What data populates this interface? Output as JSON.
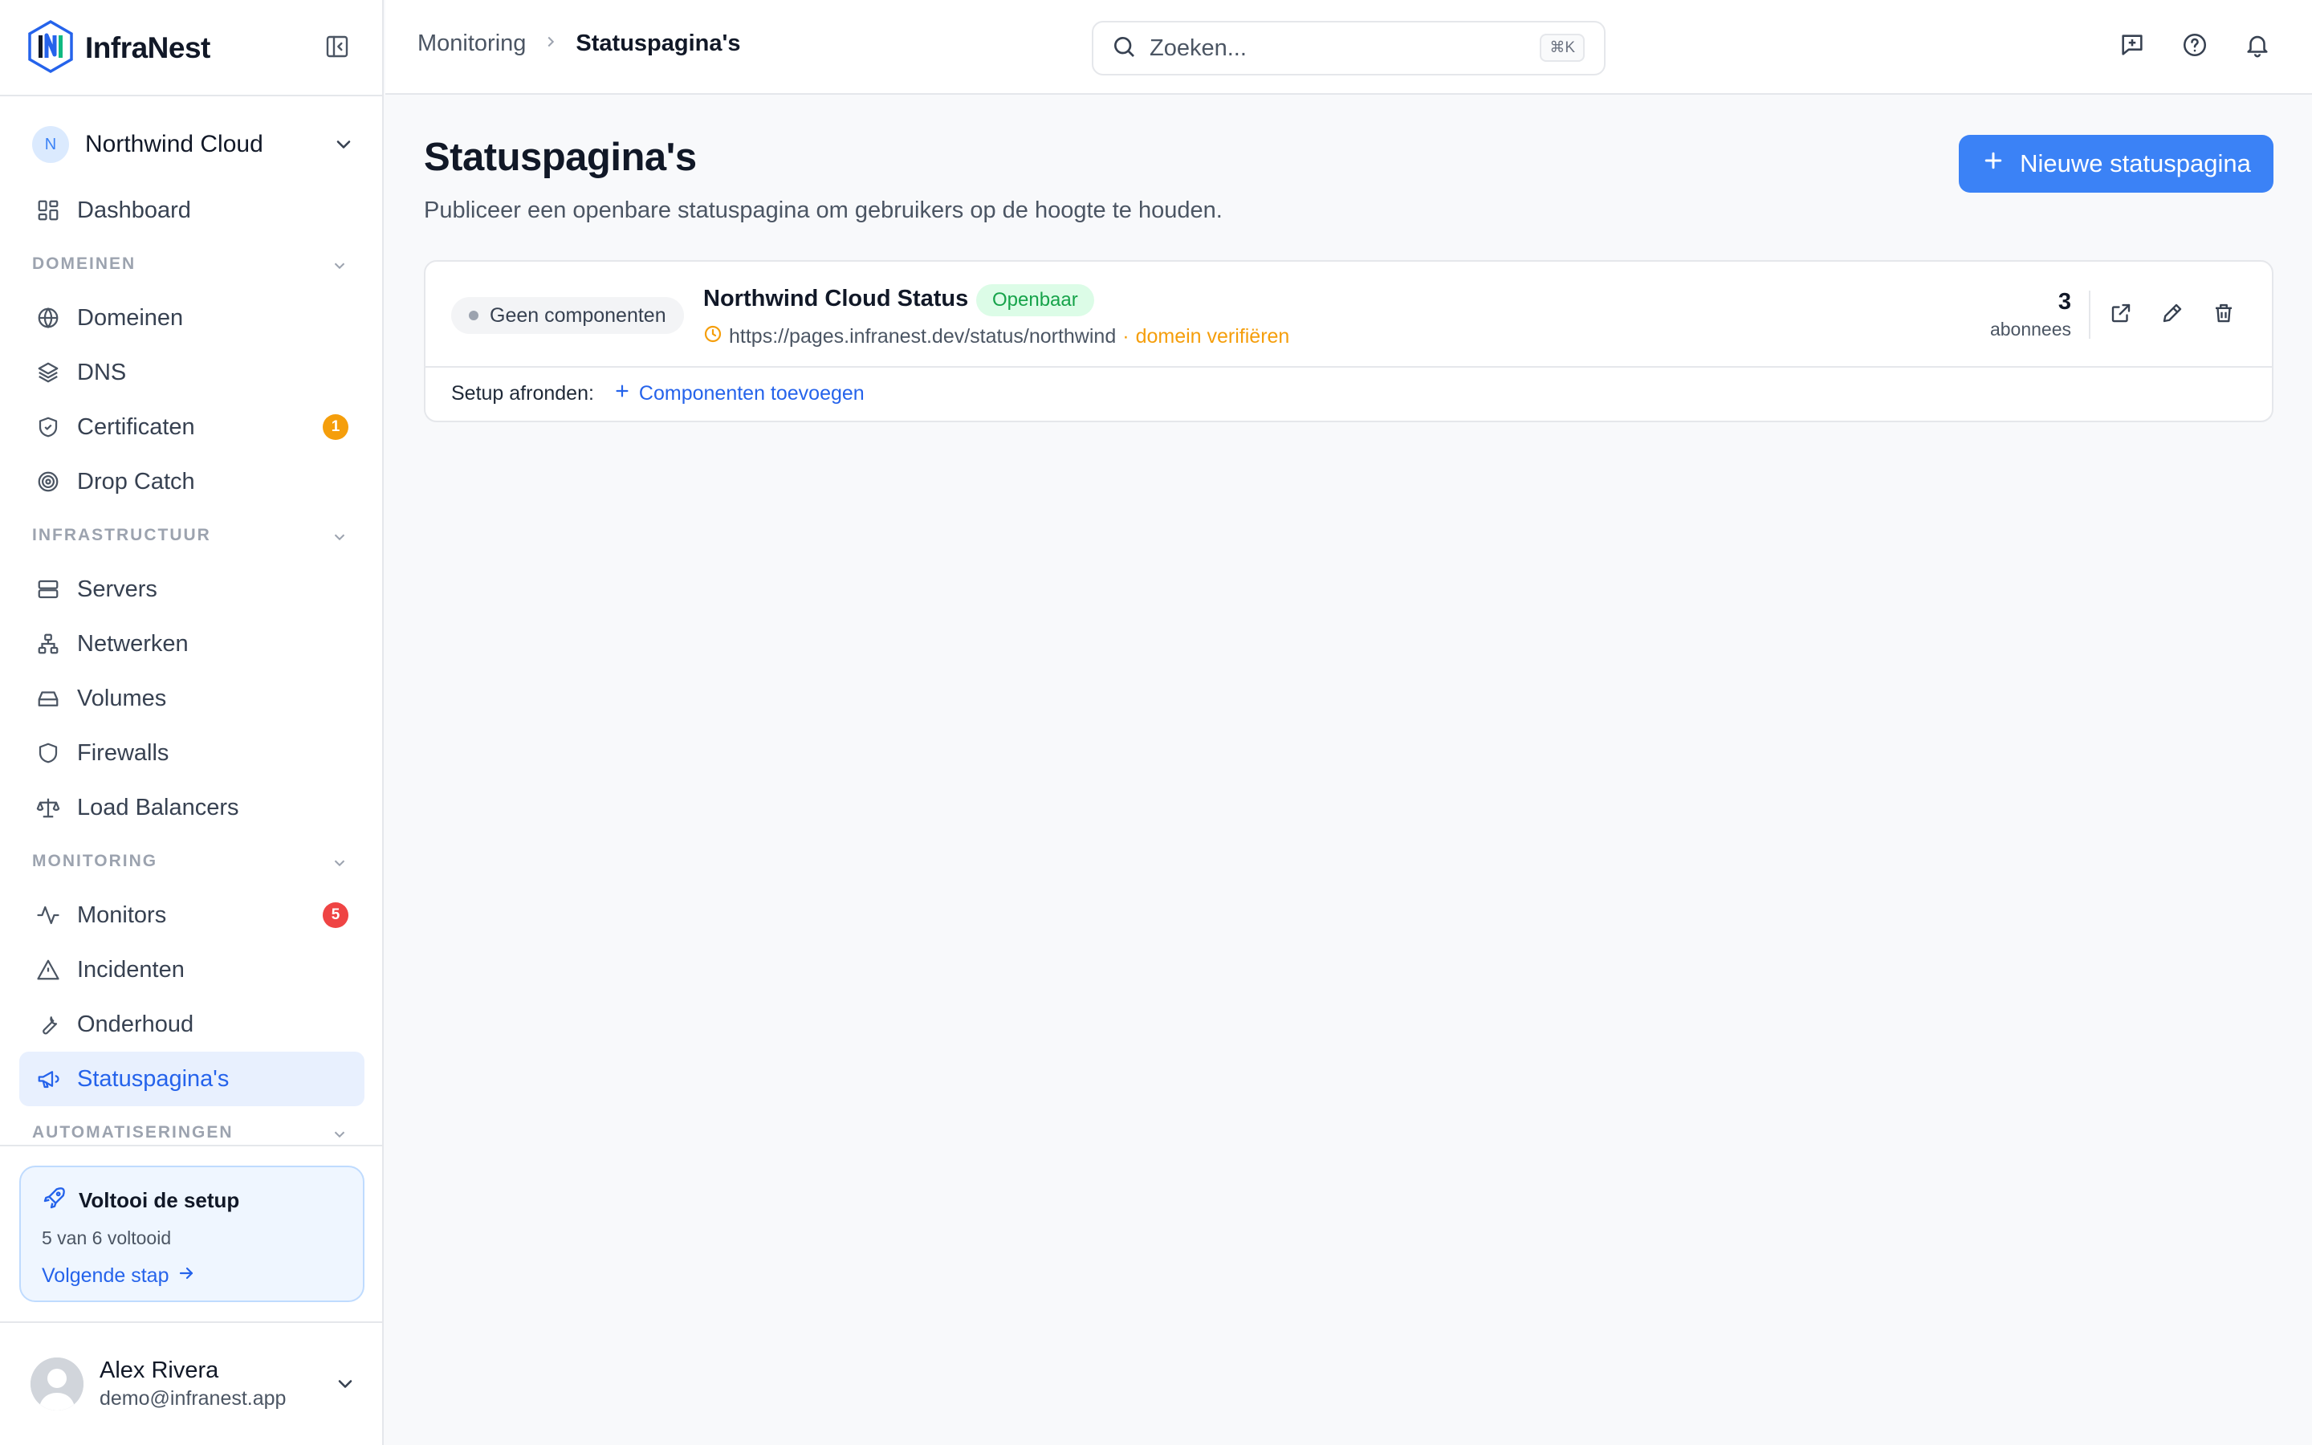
{
  "brand": {
    "name": "InfraNest"
  },
  "workspace": {
    "initial": "N",
    "name": "Northwind Cloud"
  },
  "sidebar": {
    "dashboard": "Dashboard",
    "sections": {
      "domains": "DOMEINEN",
      "infra": "INFRASTRUCTUUR",
      "monitoring": "MONITORING",
      "automation": "AUTOMATISERINGEN"
    },
    "items": {
      "domeinen": "Domeinen",
      "dns": "DNS",
      "certificaten": "Certificaten",
      "certificaten_badge": "1",
      "dropcatch": "Drop Catch",
      "servers": "Servers",
      "netwerken": "Netwerken",
      "volumes": "Volumes",
      "firewalls": "Firewalls",
      "loadbalancers": "Load Balancers",
      "monitors": "Monitors",
      "monitors_badge": "5",
      "incidenten": "Incidenten",
      "onderhoud": "Onderhoud",
      "statuspaginas": "Statuspagina's"
    }
  },
  "setup": {
    "title": "Voltooi de setup",
    "progress": "5 van 6 voltooid",
    "progress_fraction": 0.8333,
    "next": "Volgende stap"
  },
  "user": {
    "name": "Alex Rivera",
    "email": "demo@infranest.app"
  },
  "topbar": {
    "breadcrumb": [
      "Monitoring",
      "Statuspagina's"
    ],
    "search_placeholder": "Zoeken...",
    "search_shortcut": "⌘K",
    "icons": [
      "feedback-icon",
      "help-icon",
      "bell-icon"
    ]
  },
  "main": {
    "title": "Statuspagina's",
    "subtitle": "Publiceer een openbare statuspagina om gebruikers op de hoogte te houden.",
    "new_button": "Nieuwe statuspagina",
    "status_page": {
      "component_chip": "Geen componenten",
      "name": "Northwind Cloud Status",
      "visibility": "Openbaar",
      "url": "https://pages.infranest.dev/status/northwind",
      "separator": "·",
      "verify": "domein verifiëren",
      "subscribers_count": "3",
      "subscribers_label": "abonnees",
      "setup_label": "Setup afronden:",
      "add_components": "Componenten toevoegen"
    }
  },
  "colors": {
    "accent": "#3b82f6",
    "active_bg": "#e8f0fe",
    "badge_orange": "#f59e0b",
    "badge_red": "#ef4444",
    "success": "#16a34a",
    "warning": "#f59e0b"
  }
}
